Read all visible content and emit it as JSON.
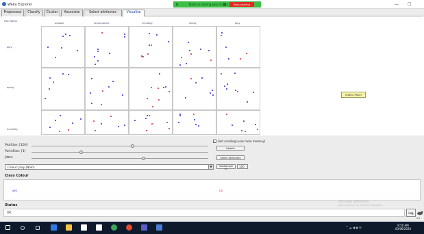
{
  "window": {
    "title": "Weka Explorer",
    "minimize_glyph": "—",
    "maximize_glyph": "☐",
    "share": {
      "text": "Teams is sharing your screen",
      "stop_label": "Stop sharing"
    }
  },
  "tabs": [
    "Preprocess",
    "Classify",
    "Cluster",
    "Associate",
    "Select attributes",
    "Visualize"
  ],
  "active_tab": "Visualize",
  "matrix": {
    "title": "Plot Matrix",
    "columns": [
      "outlook",
      "temperature",
      "humidity",
      "windy",
      "play"
    ],
    "rows": [
      "play",
      "windy",
      "humidity"
    ],
    "legend": {
      "yes": "#2a2ad0",
      "no": "#d02a2a"
    },
    "pan_label": "Matrix Panel"
  },
  "controls": {
    "plot_size_label": "PlotSize: [100]",
    "point_size_label": "PointSize: [3]",
    "jitter_label": "Jitter:",
    "plot_size_value": 0.57,
    "point_size_value": 0.28,
    "jitter_value": 0.63,
    "fast_scrolling_label": "Fast scrolling (uses more memory)",
    "update_label": "Update",
    "select_attributes_label": "Select Attributes",
    "subsample_label": "SubSample %:",
    "subsample_value": "100",
    "color_select_text": "Colour: play (Nom)",
    "color_arrow": "▼"
  },
  "class_colour": {
    "title": "Class Colour",
    "values": [
      {
        "label": "yes",
        "color": "#2a2ad0"
      },
      {
        "label": "no",
        "color": "#d02a2a"
      }
    ]
  },
  "status": {
    "title": "Status",
    "text": "OK",
    "log_label": "Log",
    "multiplier": "x 0"
  },
  "watermark": {
    "line1": "Activate Windows",
    "line2": "Go to Settings to activate Windows."
  },
  "taskbar": {
    "icons": [
      "windows-start-icon",
      "search-icon",
      "task-view-icon",
      "edge-browser-icon",
      "file-explorer-icon",
      "store-icon",
      "mail-icon",
      "chrome-icon",
      "office-icon",
      "teams-icon",
      "weka-icon"
    ],
    "time": "8:50 AM",
    "date": "03/06/2020"
  }
}
